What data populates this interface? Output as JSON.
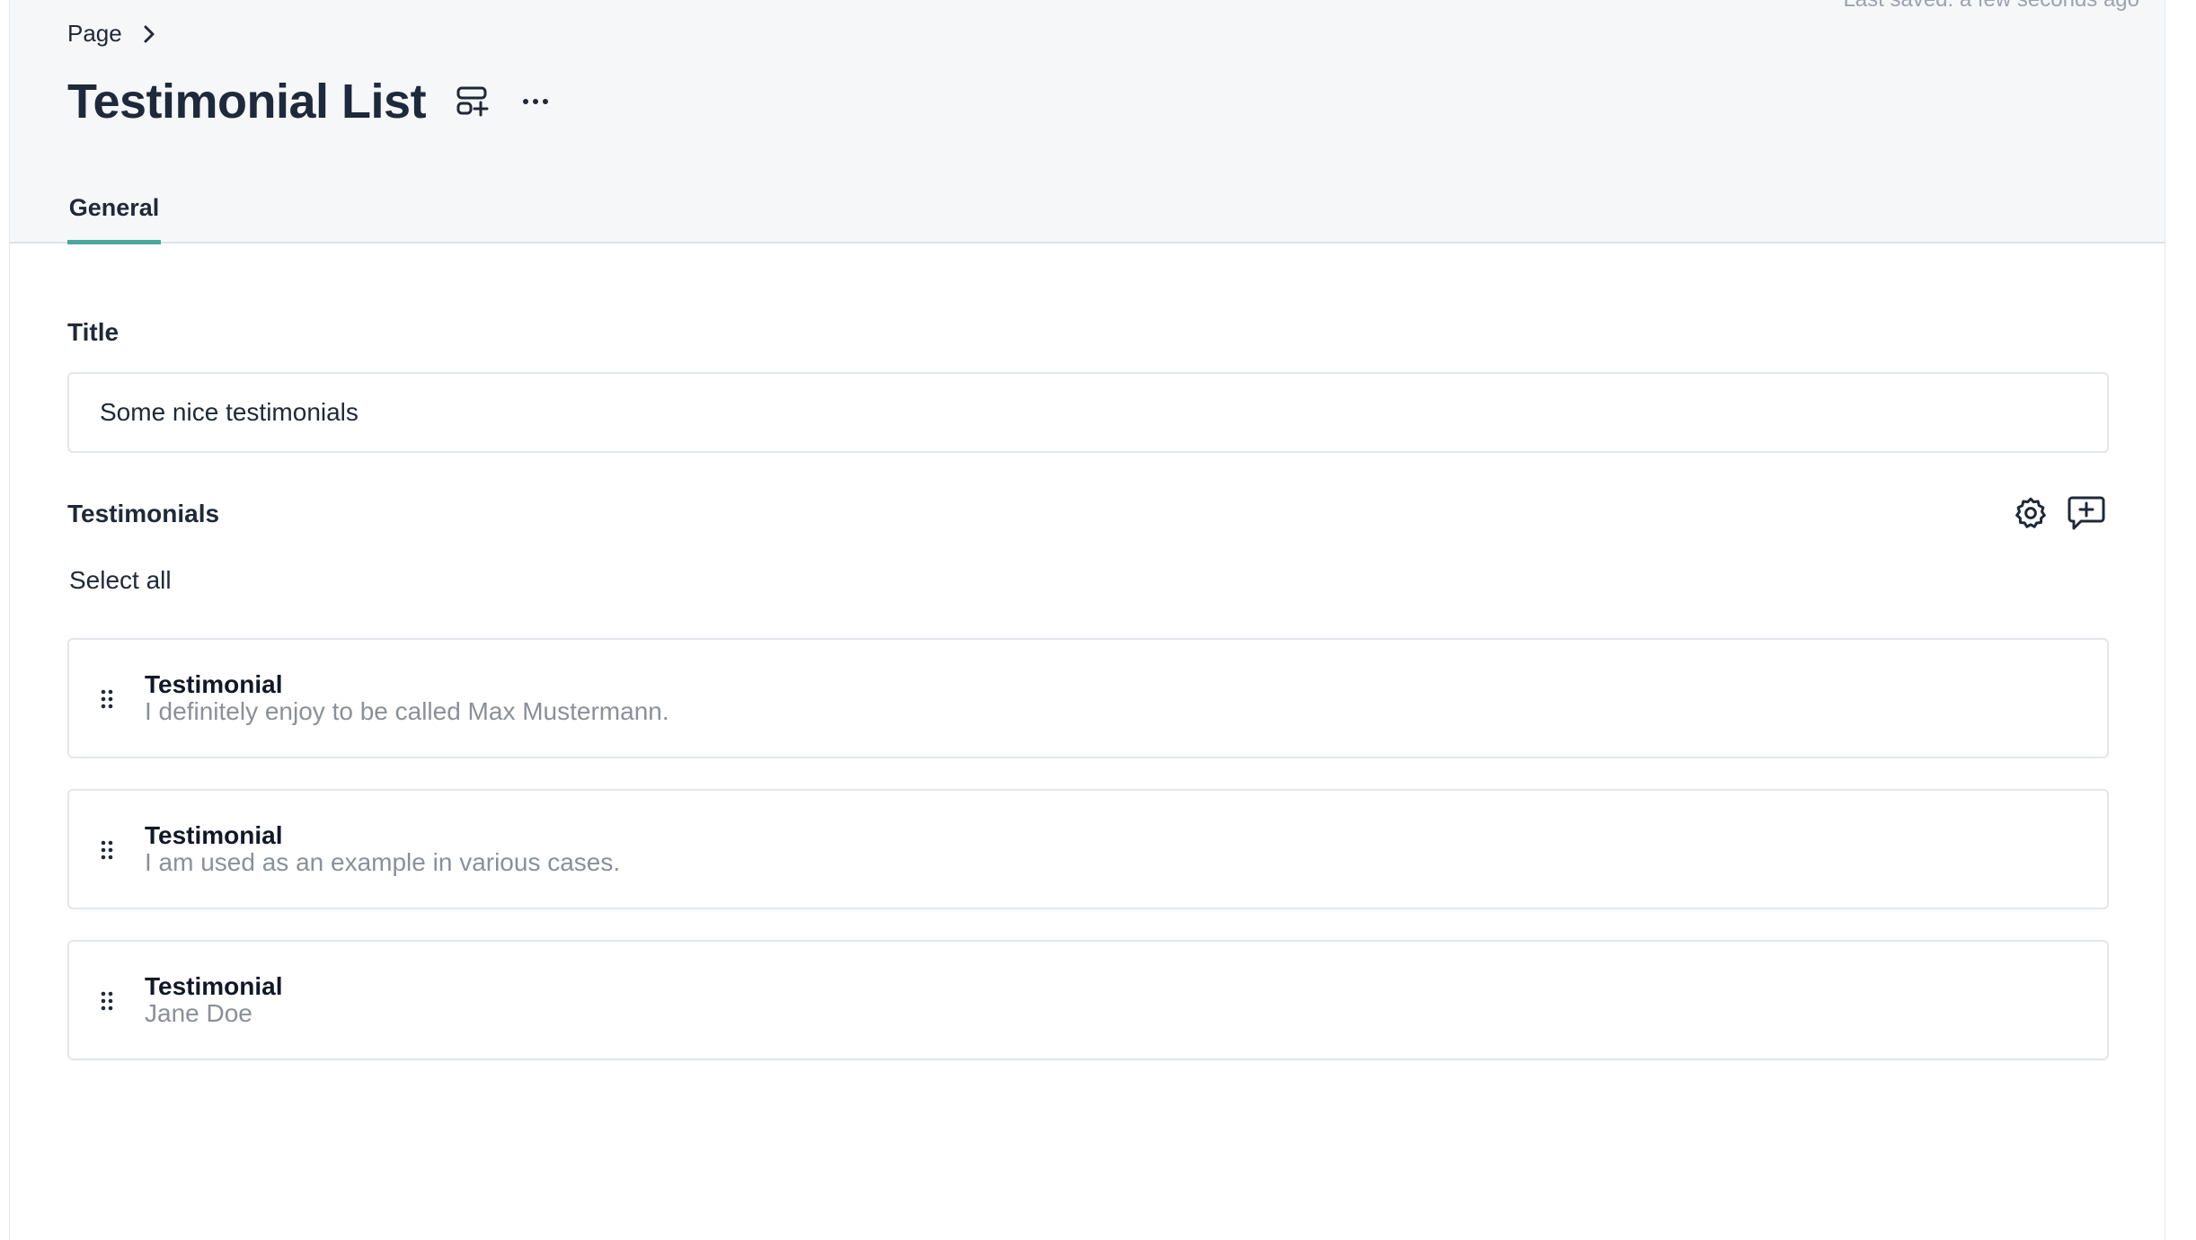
{
  "status": {
    "last_saved": "Last saved: a few seconds ago"
  },
  "breadcrumb": {
    "items": [
      "Page"
    ]
  },
  "header": {
    "title": "Testimonial List",
    "icons": [
      "add-layout-icon",
      "more-icon"
    ]
  },
  "tabs": [
    {
      "label": "General",
      "active": true
    }
  ],
  "form": {
    "title_label": "Title",
    "title_value": "Some nice testimonials",
    "testimonials_label": "Testimonials",
    "select_all_label": "Select all",
    "section_icons": [
      "settings-icon",
      "add-comment-icon"
    ]
  },
  "testimonials": [
    {
      "type": "Testimonial",
      "text": "I definitely enjoy to be called Max Mustermann."
    },
    {
      "type": "Testimonial",
      "text": "I am used as an example in various cases."
    },
    {
      "type": "Testimonial",
      "text": "Jane Doe"
    }
  ],
  "colors": {
    "accent": "#4aa8a2",
    "header_bg": "#f6f7f9",
    "muted_text": "#8a9099"
  }
}
